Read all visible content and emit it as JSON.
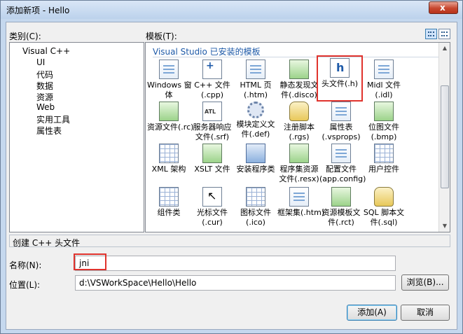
{
  "window": {
    "title": "添加新项 - Hello",
    "close": "x"
  },
  "categories": {
    "label": "类别(C):",
    "items": [
      "Visual C++",
      "UI",
      "代码",
      "数据",
      "资源",
      "Web",
      "实用工具",
      "属性表"
    ]
  },
  "templates": {
    "label": "模板(T):",
    "header": "Visual Studio 已安装的模板",
    "items": [
      {
        "icon": "form-icon",
        "line1": "Windows 窗",
        "line2": "体"
      },
      {
        "icon": "cpp-file-icon",
        "line1": "C++ 文件",
        "line2": "(.cpp)"
      },
      {
        "icon": "html-page-icon",
        "line1": "HTML 页",
        "line2": "(.htm)"
      },
      {
        "icon": "static-discovery-icon",
        "line1": "静态发现文",
        "line2": "件(.disco)"
      },
      {
        "icon": "header-file-icon",
        "line1": "头文件(.h)",
        "line2": ""
      },
      {
        "icon": "midl-file-icon",
        "line1": "Midl 文件",
        "line2": "(.idl)"
      },
      {
        "icon": "resource-file-icon",
        "line1": "资源文件(.rc)",
        "line2": ""
      },
      {
        "icon": "server-response-icon",
        "line1": "服务器响应",
        "line2": "文件(.srf)"
      },
      {
        "icon": "module-definition-icon",
        "line1": "模块定义文",
        "line2": "件(.def)"
      },
      {
        "icon": "registrar-script-icon",
        "line1": "注册脚本",
        "line2": "(.rgs)"
      },
      {
        "icon": "property-sheet-icon",
        "line1": "属性表",
        "line2": "(.vsprops)"
      },
      {
        "icon": "bitmap-file-icon",
        "line1": "位图文件",
        "line2": "(.bmp)"
      },
      {
        "icon": "xml-schema-icon",
        "line1": "XML 架构",
        "line2": ""
      },
      {
        "icon": "xslt-file-icon",
        "line1": "XSLT 文件",
        "line2": ""
      },
      {
        "icon": "installer-class-icon",
        "line1": "安装程序类",
        "line2": ""
      },
      {
        "icon": "assembly-resource-icon",
        "line1": "程序集资源",
        "line2": "文件(.resx)"
      },
      {
        "icon": "config-file-icon",
        "line1": "配置文件",
        "line2": "(app.config)"
      },
      {
        "icon": "user-control-icon",
        "line1": "用户控件",
        "line2": ""
      },
      {
        "icon": "component-class-icon",
        "line1": "组件类",
        "line2": ""
      },
      {
        "icon": "cursor-file-icon",
        "line1": "光标文件",
        "line2": "(.cur)"
      },
      {
        "icon": "icon-file-icon",
        "line1": "图标文件",
        "line2": "(.ico)"
      },
      {
        "icon": "frameset-icon",
        "line1": "框架集(.htm)",
        "line2": ""
      },
      {
        "icon": "resource-template-icon",
        "line1": "资源模板文",
        "line2": "件(.rct)"
      },
      {
        "icon": "sql-script-icon",
        "line1": "SQL 脚本文",
        "line2": "件(.sql)"
      }
    ]
  },
  "description": "创建 C++ 头文件",
  "name": {
    "label": "名称(N):",
    "value": "jni"
  },
  "location": {
    "label": "位置(L):",
    "value": "d:\\VSWorkSpace\\Hello\\Hello",
    "browse": "浏览(B)..."
  },
  "buttons": {
    "add": "添加(A)",
    "cancel": "取消"
  },
  "colors": {
    "accent": "#1e5aa8",
    "highlight": "#e0332d",
    "dialog_bg": "#f0f0f0"
  }
}
